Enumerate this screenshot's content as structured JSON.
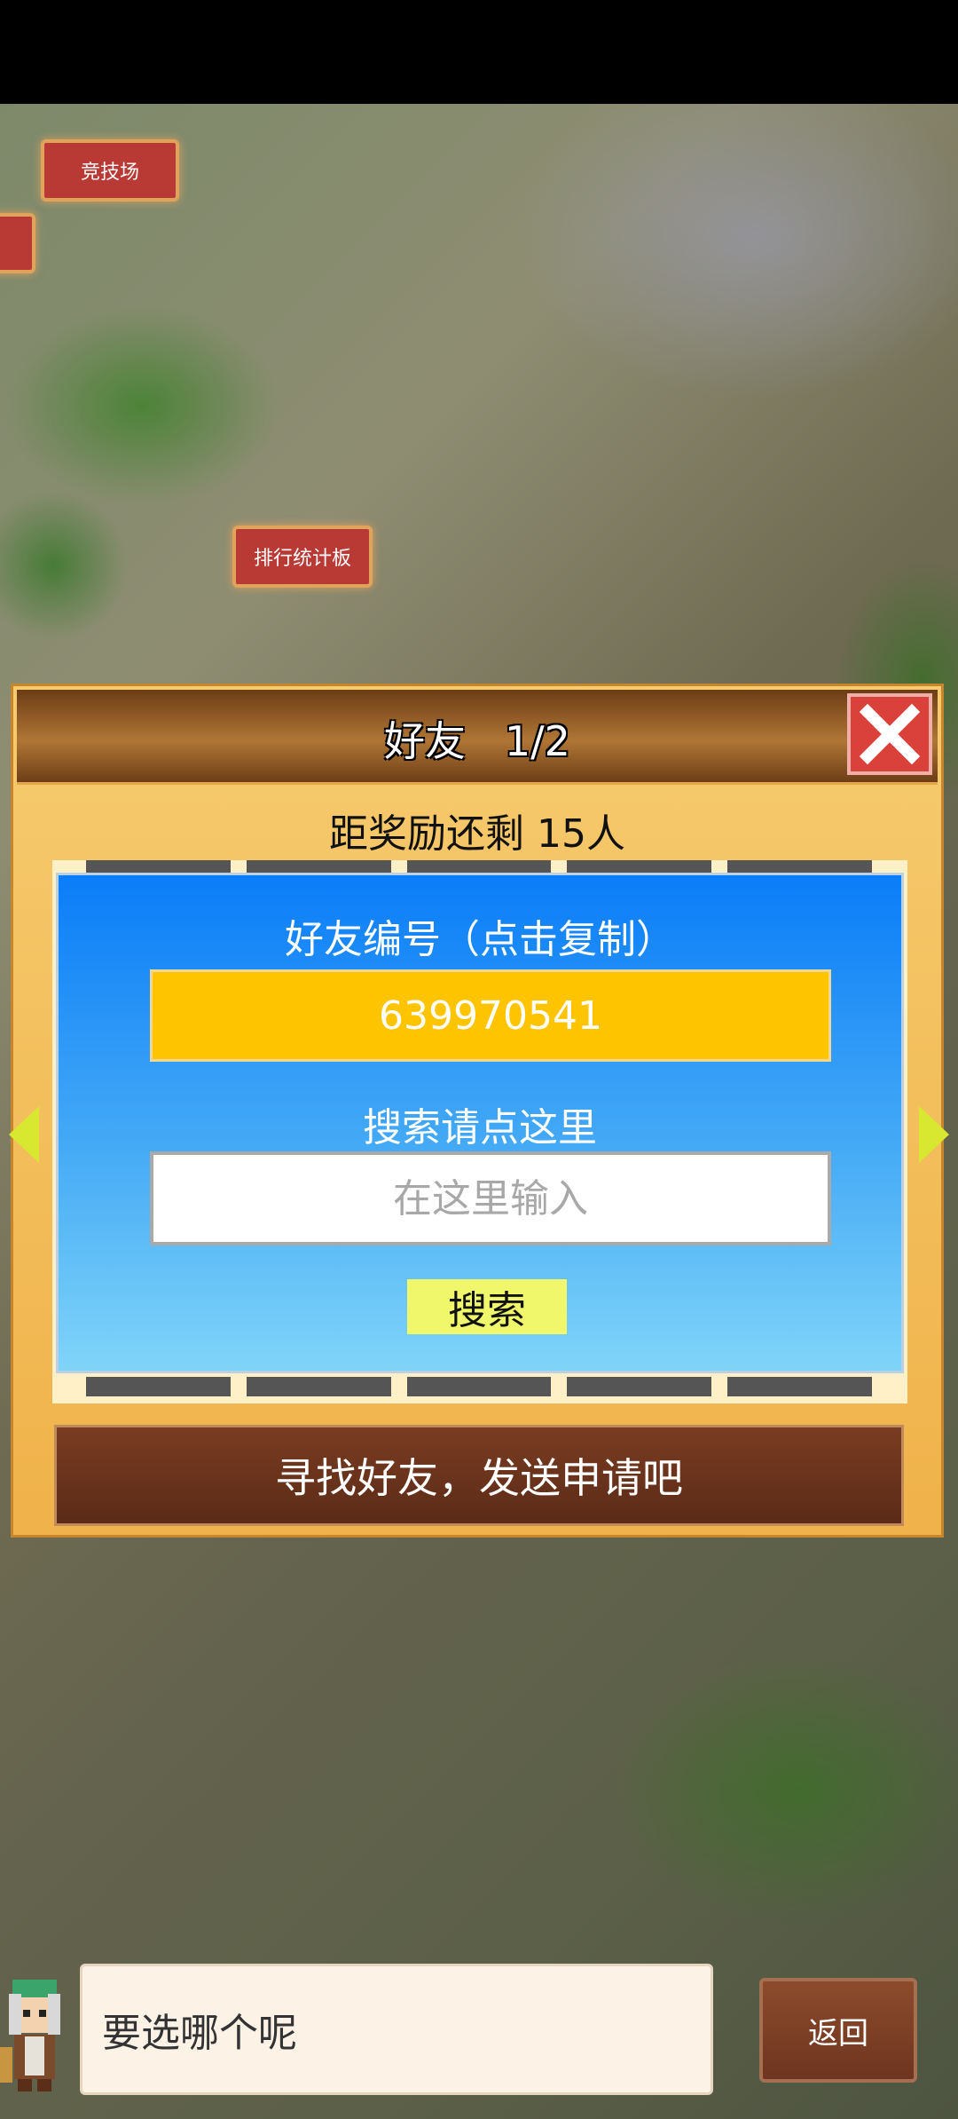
{
  "map": {
    "labels": [
      "竞技场",
      "排行统计板"
    ]
  },
  "dialog": {
    "title": "好友   1/2",
    "reward_text": "距奖励还剩 15人",
    "friend_id_label": "好友编号（点击复制）",
    "friend_id": "639970541",
    "search_label": "搜索请点这里",
    "search_placeholder": "在这里输入",
    "search_button": "搜索",
    "send_request_button": "寻找好友，发送申请吧"
  },
  "bottom": {
    "speech_text": "要选哪个呢",
    "back_button": "返回"
  },
  "colors": {
    "close_red": "#d9413a",
    "id_box_yellow": "#ffc400",
    "panel_blue": "#0a7df8",
    "search_button": "#f0f76a",
    "brown_button": "#6e3520"
  },
  "icons": [
    "close-icon",
    "arrow-left-icon",
    "arrow-right-icon",
    "character-avatar-icon"
  ]
}
